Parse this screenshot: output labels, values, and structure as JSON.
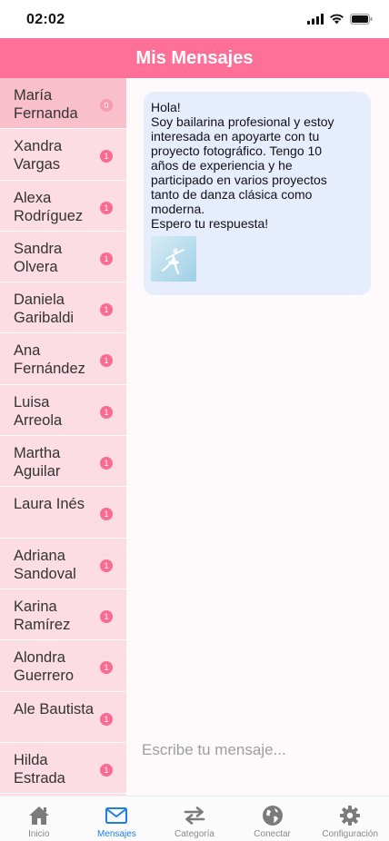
{
  "status_bar": {
    "time": "02:02"
  },
  "header": {
    "title": "Mis Mensajes"
  },
  "contacts": [
    {
      "name": "María Fernanda",
      "unread": "0",
      "active": true
    },
    {
      "name": "Xandra Vargas",
      "unread": "1"
    },
    {
      "name": "Alexa Rodríguez",
      "unread": "1"
    },
    {
      "name": "Sandra Olvera",
      "unread": "1"
    },
    {
      "name": "Daniela Garibaldi",
      "unread": "1"
    },
    {
      "name": "Ana Fernández",
      "unread": "1"
    },
    {
      "name": "Luisa Arreola",
      "unread": "1"
    },
    {
      "name": "Martha Aguilar",
      "unread": "1"
    },
    {
      "name": "Laura Inés",
      "unread": "1"
    },
    {
      "name": "Adriana Sandoval",
      "unread": "1"
    },
    {
      "name": "Karina Ramírez",
      "unread": "1"
    },
    {
      "name": "Alondra Guerrero",
      "unread": "1"
    },
    {
      "name": "Ale Bautista",
      "unread": "1"
    },
    {
      "name": "Hilda Estrada",
      "unread": "1"
    }
  ],
  "message": {
    "lines": [
      "Hola!",
      "Soy bailarina profesional y estoy",
      "interesada en apoyarte con tu",
      "proyecto fotográfico. Tengo 10",
      "años de experiencia y he",
      "participado en varios proyectos",
      "tanto de danza clásica como",
      "moderna.",
      "Espero tu respuesta!"
    ]
  },
  "composer": {
    "placeholder": "Escribe tu mensaje..."
  },
  "tabs": [
    {
      "label": "Inicio",
      "icon": "home-icon"
    },
    {
      "label": "Mensajes",
      "icon": "mail-icon",
      "active": true
    },
    {
      "label": "Categoría",
      "icon": "swap-arrows-icon"
    },
    {
      "label": "Conectar",
      "icon": "globe-icon"
    },
    {
      "label": "Configuración",
      "icon": "gear-icon"
    }
  ],
  "colors": {
    "accent": "#ff7098",
    "badge": "#fa6b92",
    "sidebar_bg": "#fbdde3",
    "active_contact_bg": "#f9bfcb",
    "bubble_bg": "#e6edfd",
    "active_tab": "#1c7fe8"
  }
}
